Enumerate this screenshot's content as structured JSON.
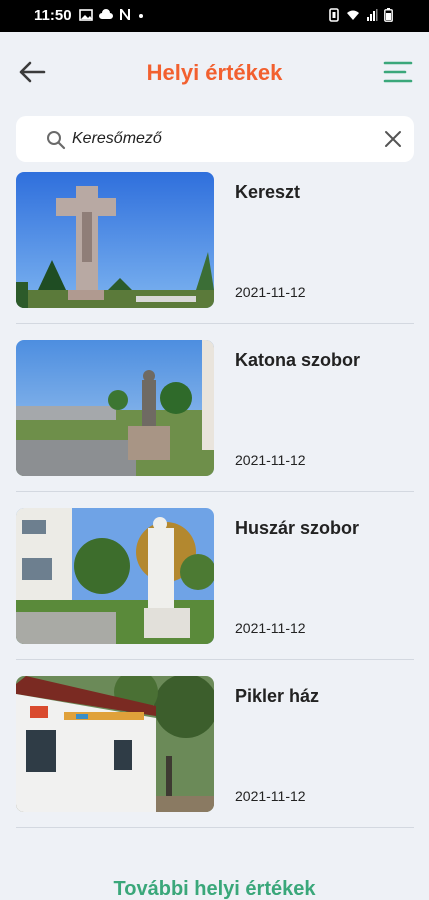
{
  "status_bar": {
    "time": "11:50",
    "left_icons": [
      "image-icon",
      "cloud-icon",
      "n-icon",
      "dot-icon"
    ],
    "right_icons": [
      "vibrate-icon",
      "wifi-icon",
      "signal-icon",
      "battery-icon"
    ]
  },
  "app_bar": {
    "title": "Helyi értékek",
    "accent_color": "#f2602f",
    "menu_color": "#3aa77a"
  },
  "search": {
    "placeholder": "Keresőmező"
  },
  "items": [
    {
      "title": "Kereszt",
      "date": "2021-11-12"
    },
    {
      "title": "Katona szobor",
      "date": "2021-11-12"
    },
    {
      "title": "Huszár szobor",
      "date": "2021-11-12"
    },
    {
      "title": "Pikler ház",
      "date": "2021-11-12"
    }
  ],
  "more_link": "További helyi értékek"
}
